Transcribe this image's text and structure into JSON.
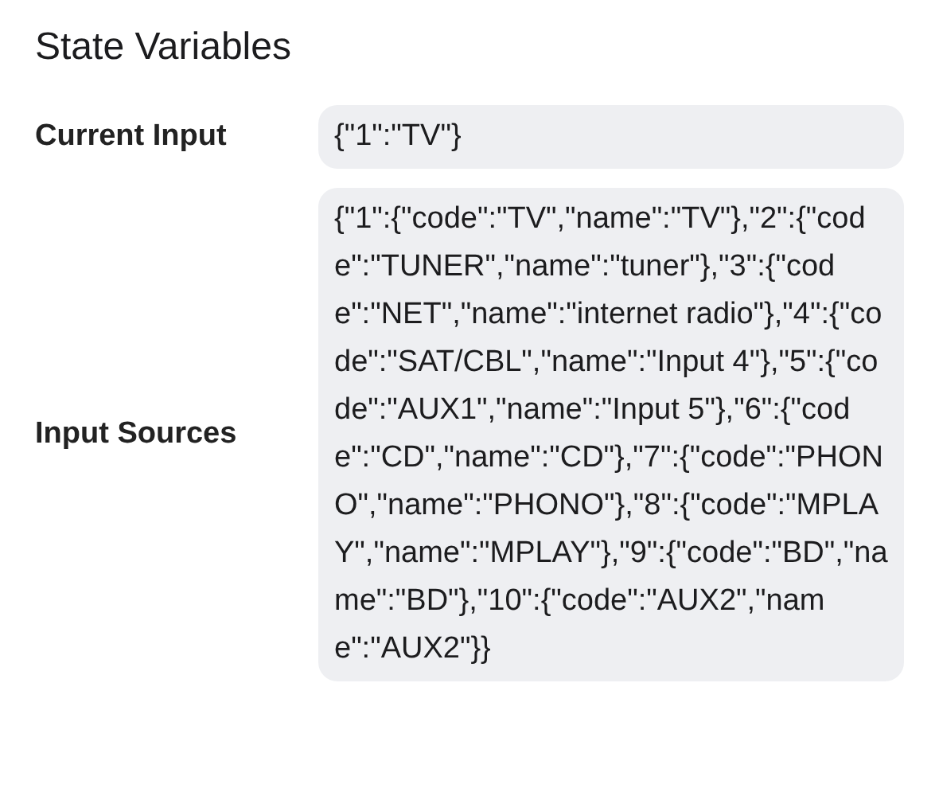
{
  "title": "State Variables",
  "variables": [
    {
      "label": "Current Input",
      "value": "{\"1\":\"TV\"}"
    },
    {
      "label": "Input Sources",
      "value": "{\"1\":{\"code\":\"TV\",\"name\":\"TV\"},\"2\":{\"code\":\"TUNER\",\"name\":\"tuner\"},\"3\":{\"code\":\"NET\",\"name\":\"internet radio\"},\"4\":{\"code\":\"SAT/CBL\",\"name\":\"Input 4\"},\"5\":{\"code\":\"AUX1\",\"name\":\"Input 5\"},\"6\":{\"code\":\"CD\",\"name\":\"CD\"},\"7\":{\"code\":\"PHONO\",\"name\":\"PHONO\"},\"8\":{\"code\":\"MPLAY\",\"name\":\"MPLAY\"},\"9\":{\"code\":\"BD\",\"name\":\"BD\"},\"10\":{\"code\":\"AUX2\",\"name\":\"AUX2\"}}"
    }
  ]
}
